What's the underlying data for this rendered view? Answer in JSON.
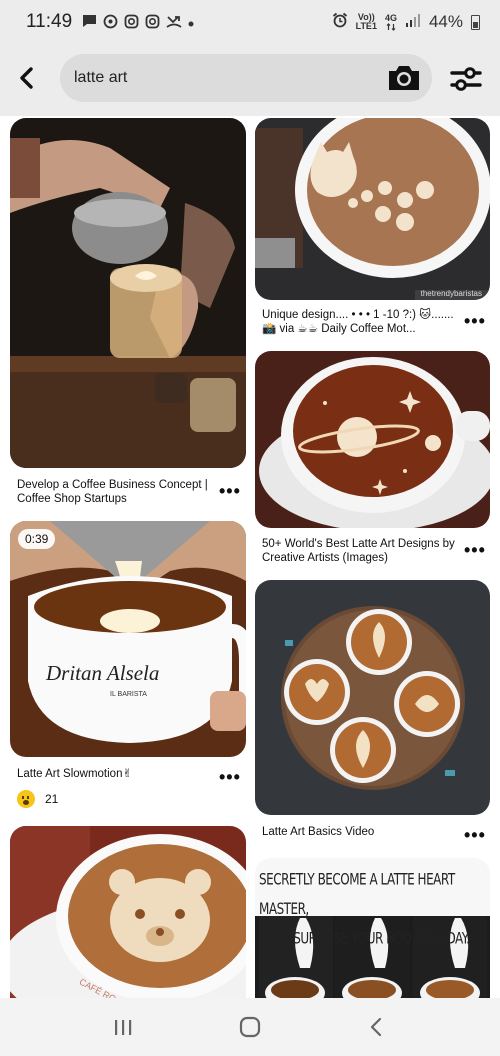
{
  "status_bar": {
    "time": "11:49",
    "network_top": "Vo))",
    "network_bottom": "LTE1",
    "net_4g": "4G",
    "battery": "44%"
  },
  "search": {
    "value": "latte art",
    "icons": {
      "back": "back-arrow-icon",
      "camera": "camera-icon",
      "filter": "filter-sliders-icon"
    }
  },
  "pins": [
    {
      "title": "Develop a Coffee Business Concept | Coffee Shop Startups",
      "more": "•••"
    },
    {
      "title": "Unique design.... • • • 1 -10 ?:) 🐱.......📸 via ☕☕ Daily Coffee Mot...",
      "more": "•••",
      "watermark": "thetrendybaristas"
    },
    {
      "title": "Latte Art Slowmotion✌",
      "more": "•••",
      "duration": "0:39",
      "cup_text": "Dritan Alsela",
      "cup_subtext": "IL BARISTA",
      "reaction_count": "21"
    },
    {
      "title": "50+ World's Best Latte Art Designs by Creative Artists (Images)",
      "more": "•••"
    },
    {
      "title": "Latte Art Basics Video",
      "more": "•••"
    },
    {
      "title": "",
      "more": "",
      "cup_text": "CAFÉ RO"
    },
    {
      "title": "",
      "more": "",
      "overlay_line1": "SECRETLY BECOME A LATTE HEART MASTER,",
      "overlay_line2": "THEN SURPRISE YOUR BOO ON V-DAY."
    }
  ],
  "colors": {
    "status_bg": "#ececec",
    "search_bg": "#dcdcdc",
    "nav_bg": "#f3f3f3"
  }
}
